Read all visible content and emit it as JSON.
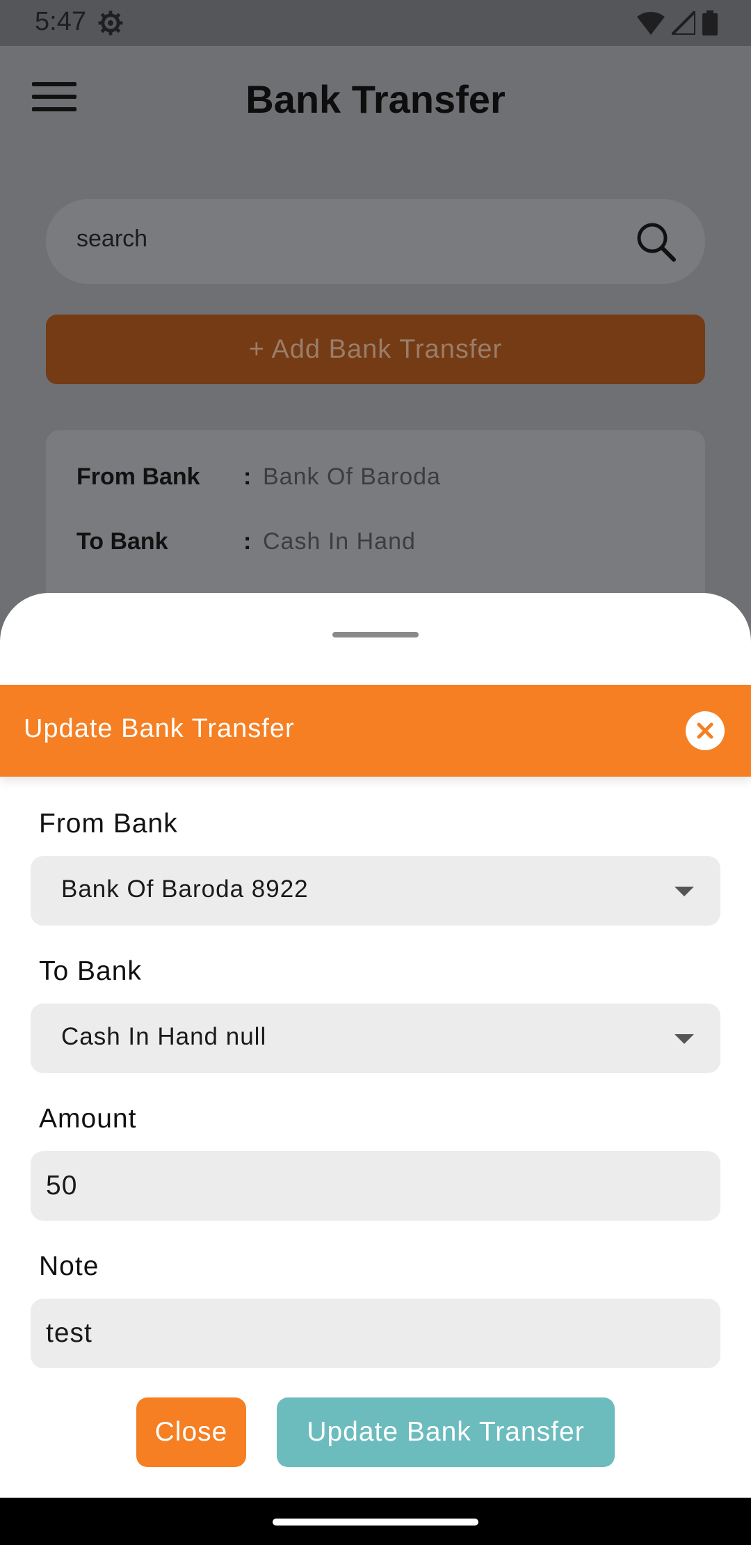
{
  "status_bar": {
    "time": "5:47"
  },
  "app": {
    "title": "Bank Transfer",
    "search": {
      "placeholder": "search"
    },
    "add_button": "+ Add Bank Transfer",
    "card": {
      "rows": [
        {
          "label": "From Bank",
          "colon": ":",
          "value": "Bank Of Baroda"
        },
        {
          "label": "To Bank",
          "colon": ":",
          "value": "Cash In Hand"
        }
      ]
    }
  },
  "sheet": {
    "title": "Update Bank Transfer",
    "fields": {
      "from_bank": {
        "label": "From Bank",
        "value": "Bank Of Baroda 8922"
      },
      "to_bank": {
        "label": "To Bank",
        "value": "Cash In Hand null"
      },
      "amount": {
        "label": "Amount",
        "value": "50"
      },
      "note": {
        "label": "Note",
        "value": "test"
      }
    },
    "buttons": {
      "close": "Close",
      "update": "Update Bank Transfer"
    }
  },
  "colors": {
    "accent": "#f57f22",
    "update_button": "#6cbcbe",
    "field_bg": "#ececec"
  },
  "icons": [
    "gear-icon",
    "wifi-icon",
    "signal-icon",
    "battery-icon",
    "menu-icon",
    "search-icon",
    "close-icon",
    "dropdown-caret-icon"
  ]
}
